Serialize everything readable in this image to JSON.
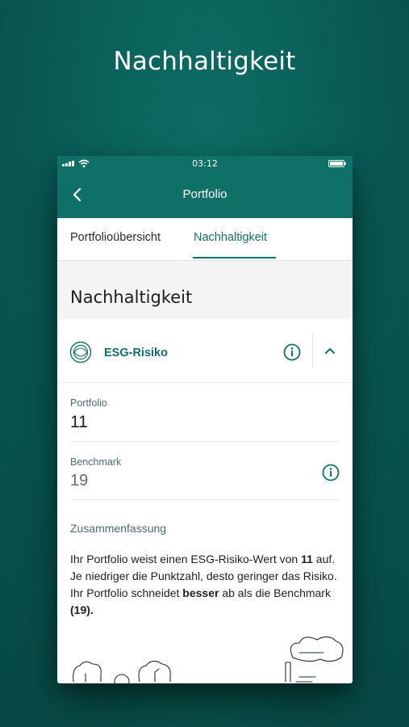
{
  "marketing": {
    "title": "Nachhaltigkeit"
  },
  "statusbar": {
    "time": "03:12"
  },
  "navbar": {
    "title": "Portfolio"
  },
  "tabs": [
    {
      "label": "Portfolioübersicht",
      "active": false
    },
    {
      "label": "Nachhaltigkeit",
      "active": true
    }
  ],
  "section": {
    "title": "Nachhaltigkeit"
  },
  "esg": {
    "label": "ESG-Risiko"
  },
  "metrics": {
    "portfolio": {
      "label": "Portfolio",
      "value": "11"
    },
    "benchmark": {
      "label": "Benchmark",
      "value": "19"
    }
  },
  "summary": {
    "heading": "Zusammenfassung",
    "parts": {
      "p1": "Ihr Portfolio weist einen ESG-Risiko-Wert von ",
      "b1": "11",
      "p2": " auf. Je niedriger die Punktzahl, desto geringer das Risiko. Ihr Portfolio schneidet ",
      "b2": "besser",
      "p3": " ab als die Benchmark ",
      "b3": "(19)."
    }
  },
  "colors": {
    "brand": "#0f7068",
    "background": "#0a5f58"
  },
  "icons": [
    "back-arrow-icon",
    "info-icon",
    "chevron-up-icon",
    "esg-emblem-icon",
    "signal-icon",
    "wifi-icon",
    "battery-icon"
  ]
}
